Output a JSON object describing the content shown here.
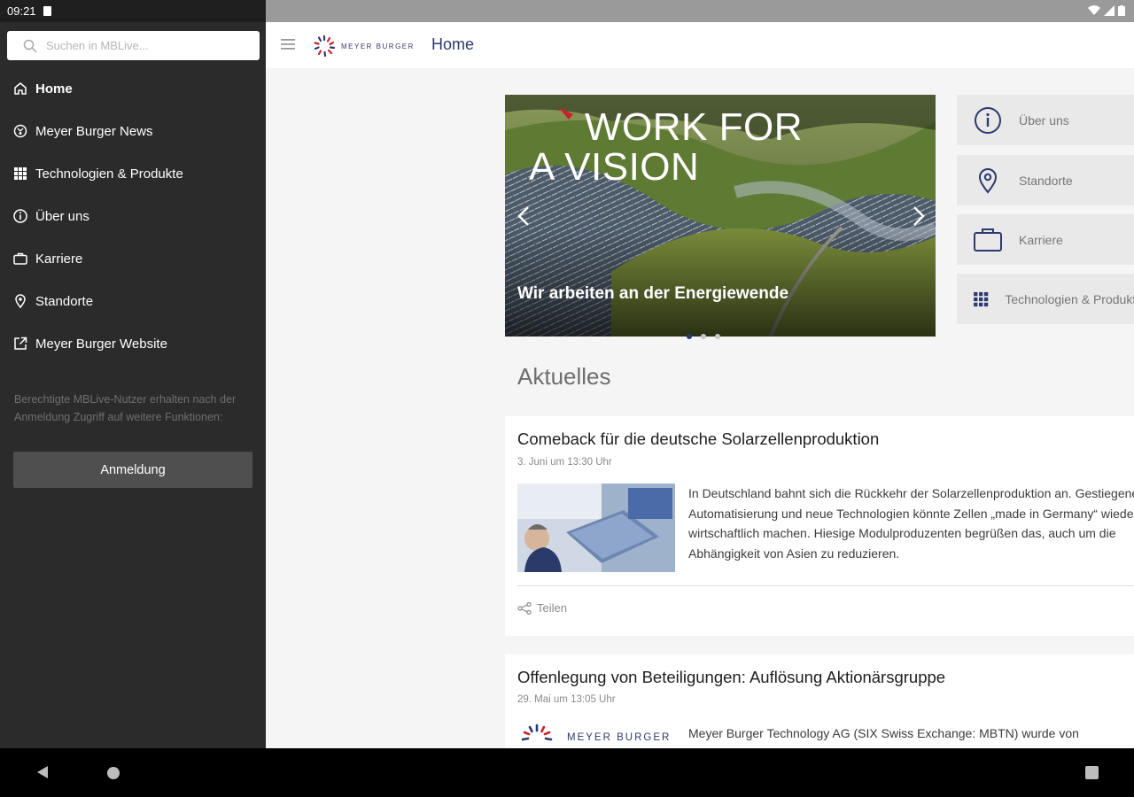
{
  "status": {
    "time": "09:21"
  },
  "drawer": {
    "search_placeholder": "Suchen in MBLive...",
    "items": [
      {
        "label": "Home",
        "icon": "home-icon"
      },
      {
        "label": "Meyer Burger News",
        "icon": "news-icon"
      },
      {
        "label": "Technologien & Produkte",
        "icon": "grid-icon"
      },
      {
        "label": "Über uns",
        "icon": "info-icon"
      },
      {
        "label": "Karriere",
        "icon": "briefcase-icon"
      },
      {
        "label": "Standorte",
        "icon": "location-pin-icon"
      },
      {
        "label": "Meyer Burger Website",
        "icon": "external-link-icon"
      }
    ],
    "note": "Berechtigte MBLive-Nutzer erhalten nach der Anmeldung Zugriff auf weitere Funktionen:",
    "login_label": "Anmeldung"
  },
  "appbar": {
    "brand": "MEYER BURGER",
    "title": "Home"
  },
  "hero": {
    "headline_1": "WORK FOR",
    "headline_2": "A VISION",
    "caption": "Wir arbeiten an der Energiewende"
  },
  "quick_links": [
    {
      "label": "Über uns",
      "icon": "info-icon"
    },
    {
      "label": "Standorte",
      "icon": "location-pin-icon"
    },
    {
      "label": "Karriere",
      "icon": "briefcase-icon"
    },
    {
      "label": "Technologien & Produkte",
      "icon": "grid-icon"
    }
  ],
  "section_title": "Aktuelles",
  "articles": [
    {
      "title": "Comeback für die deutsche Solarzellenproduktion",
      "date": "3. Juni um 13:30 Uhr",
      "body": "In Deutschland bahnt sich die Rückkehr der Solarzellenproduktion an. Gestiegene Automatisierung und neue Technologien könnte Zellen „made in Germany“ wieder wirtschaftlich machen. Hiesige Modulproduzenten begrüßen das, auch um die Abhängigkeit von Asien zu reduzieren.",
      "share_label": "Teilen"
    },
    {
      "title": "Offenlegung von Beteiligungen: Auflösung Aktionärsgruppe",
      "date": "29. Mai um 13:05 Uhr",
      "thumb_brand": "MEYER BURGER",
      "body": "Meyer Burger Technology AG (SIX Swiss Exchange: MBTN) wurde von"
    }
  ],
  "colors": {
    "drawer_bg": "#2b2b2b",
    "brand_blue": "#2d3a6e",
    "accent_red": "#d0202a"
  }
}
